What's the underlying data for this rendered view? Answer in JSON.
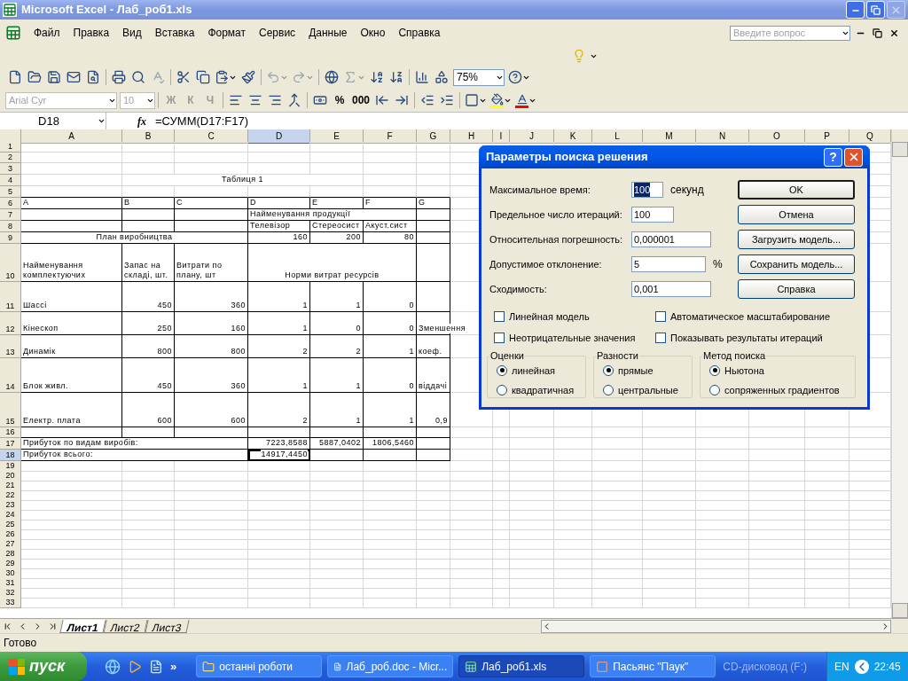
{
  "window": {
    "title": "Microsoft Excel - Лаб_роб1.xls"
  },
  "menu": [
    "Файл",
    "Правка",
    "Вид",
    "Вставка",
    "Формат",
    "Сервис",
    "Данные",
    "Окно",
    "Справка"
  ],
  "help_search": {
    "placeholder": "Введите вопрос"
  },
  "standard_toolbar": {
    "zoom": "75%",
    "buttons": [
      {
        "disabled": false
      },
      {
        "disabled": false
      },
      {
        "disabled": false
      },
      {
        "disabled": false
      },
      {
        "disabled": false
      },
      {
        "disabled": false
      },
      {
        "disabled": false
      },
      {
        "disabled": true
      },
      {
        "disabled": false
      },
      {
        "disabled": false
      },
      {
        "disabled": false
      },
      {
        "disabled": false
      },
      {
        "disabled": true
      },
      {
        "disabled": true
      },
      {
        "disabled": false
      },
      {
        "disabled": true
      },
      {
        "disabled": false
      },
      {
        "disabled": false
      },
      {
        "disabled": false
      },
      {
        "disabled": false
      },
      {
        "disabled": false
      }
    ]
  },
  "formatting_toolbar": {
    "font": {
      "value": "Arial Cyr",
      "disabled": true
    },
    "size": {
      "value": "10",
      "disabled": true
    },
    "buttons": [
      {
        "kind": "text",
        "label": "Ж",
        "disabled": true
      },
      {
        "kind": "text",
        "label": "К",
        "disabled": true
      },
      {
        "kind": "text",
        "label": "Ч",
        "disabled": true
      },
      {
        "kind": "icon",
        "disabled": false
      },
      {
        "kind": "icon",
        "disabled": false
      },
      {
        "kind": "icon",
        "disabled": false
      },
      {
        "kind": "icon",
        "disabled": false
      },
      {
        "kind": "icon",
        "disabled": false
      },
      {
        "kind": "text",
        "label": "%",
        "disabled": false
      },
      {
        "kind": "text",
        "label": "000",
        "disabled": false
      },
      {
        "kind": "icon",
        "disabled": false
      },
      {
        "kind": "icon",
        "disabled": false
      },
      {
        "kind": "icon",
        "disabled": false
      },
      {
        "kind": "icon",
        "disabled": false
      },
      {
        "kind": "icon",
        "disabled": false
      },
      {
        "kind": "icon",
        "disabled": false
      },
      {
        "kind": "icon",
        "disabled": false
      }
    ]
  },
  "formula_bar": {
    "name_box": "D18",
    "fx": "fx",
    "formula": "=СУММ(D17:F17)"
  },
  "sheet": {
    "columns": [
      {
        "label": "A",
        "selected": false
      },
      {
        "label": "B",
        "selected": false
      },
      {
        "label": "C",
        "selected": false
      },
      {
        "label": "D",
        "selected": true
      },
      {
        "label": "E",
        "selected": false
      },
      {
        "label": "F",
        "selected": false
      },
      {
        "label": "G",
        "selected": false
      },
      {
        "label": "H",
        "selected": false
      },
      {
        "label": "I",
        "selected": false
      },
      {
        "label": "J",
        "selected": false
      },
      {
        "label": "K",
        "selected": false
      },
      {
        "label": "L",
        "selected": false
      },
      {
        "label": "M",
        "selected": false
      },
      {
        "label": "N",
        "selected": false
      },
      {
        "label": "O",
        "selected": false
      },
      {
        "label": "P",
        "selected": false
      },
      {
        "label": "Q",
        "selected": false
      }
    ],
    "rows": [
      {
        "number": "1",
        "selected": false,
        "bordered": false
      },
      {
        "number": "2",
        "selected": false,
        "bordered": false
      },
      {
        "number": "3",
        "selected": false,
        "bordered": false
      },
      {
        "number": "4",
        "selected": false,
        "bordered": false,
        "cells": [
          {
            "kind": "empty"
          },
          {
            "kind": "heading",
            "text": "Таблиця 1"
          },
          {
            "kind": "merged"
          },
          {
            "kind": "merged"
          },
          {
            "kind": "merged"
          }
        ]
      },
      {
        "number": "5",
        "selected": false,
        "bordered": false
      },
      {
        "number": "6",
        "selected": false,
        "bordered": true,
        "cells": [
          {
            "kind": "label",
            "text": "A"
          },
          {
            "kind": "label",
            "text": "B"
          },
          {
            "kind": "label",
            "text": "C"
          },
          {
            "kind": "label",
            "text": "D"
          },
          {
            "kind": "label",
            "text": "E"
          },
          {
            "kind": "label",
            "text": "F"
          },
          {
            "kind": "label",
            "text": "G"
          }
        ]
      },
      {
        "number": "7",
        "selected": false,
        "bordered": true,
        "cells": [
          {
            "kind": "empty"
          },
          {
            "kind": "empty"
          },
          {
            "kind": "empty"
          },
          {
            "kind": "label",
            "text": "Найменування продукції"
          },
          {
            "kind": "merged"
          },
          {
            "kind": "merged"
          },
          {
            "kind": "empty"
          }
        ]
      },
      {
        "number": "8",
        "selected": false,
        "bordered": true,
        "cells": [
          {
            "kind": "empty"
          },
          {
            "kind": "empty"
          },
          {
            "kind": "empty"
          },
          {
            "kind": "label",
            "text": "Телевізор"
          },
          {
            "kind": "label",
            "text": "Стереосист"
          },
          {
            "kind": "label",
            "text": "Акуст.сист"
          },
          {
            "kind": "empty"
          }
        ]
      },
      {
        "number": "9",
        "selected": false,
        "bordered": true,
        "cells": [
          {
            "kind": "heading",
            "text": "План виробництва"
          },
          {
            "kind": "merged"
          },
          {
            "kind": "merged"
          },
          {
            "kind": "number",
            "text": "160"
          },
          {
            "kind": "number",
            "text": "200"
          },
          {
            "kind": "number",
            "text": "80"
          },
          {
            "kind": "empty"
          }
        ]
      },
      {
        "number": "10",
        "selected": false,
        "bordered": true,
        "cells": [
          {
            "kind": "wrapped",
            "text": "Найменування комплектуючих"
          },
          {
            "kind": "wrapped",
            "text": "Запас на складі, шт."
          },
          {
            "kind": "wrapped",
            "text": "Витрати по плану, шт"
          },
          {
            "kind": "heading",
            "text": "Норми витрат ресурсів"
          },
          {
            "kind": "merged"
          },
          {
            "kind": "merged"
          },
          {
            "kind": "empty"
          }
        ]
      },
      {
        "number": "11",
        "selected": false,
        "bordered": true,
        "cells": [
          {
            "kind": "label",
            "text": "Шассі"
          },
          {
            "kind": "number",
            "text": "450"
          },
          {
            "kind": "number",
            "text": "360"
          },
          {
            "kind": "number",
            "text": "1"
          },
          {
            "kind": "number",
            "text": "1"
          },
          {
            "kind": "number",
            "text": "0"
          },
          {
            "kind": "empty"
          }
        ]
      },
      {
        "number": "12",
        "selected": false,
        "bordered": true,
        "cells": [
          {
            "kind": "label",
            "text": "Кінескоп"
          },
          {
            "kind": "number",
            "text": "250"
          },
          {
            "kind": "number",
            "text": "160"
          },
          {
            "kind": "number",
            "text": "1"
          },
          {
            "kind": "number",
            "text": "0"
          },
          {
            "kind": "number",
            "text": "0"
          },
          {
            "kind": "label",
            "text": "Зменшення"
          }
        ]
      },
      {
        "number": "13",
        "selected": false,
        "bordered": true,
        "cells": [
          {
            "kind": "label",
            "text": "Динамік"
          },
          {
            "kind": "number",
            "text": "800"
          },
          {
            "kind": "number",
            "text": "800"
          },
          {
            "kind": "number",
            "text": "2"
          },
          {
            "kind": "number",
            "text": "2"
          },
          {
            "kind": "number",
            "text": "1"
          },
          {
            "kind": "label",
            "text": "коеф."
          }
        ]
      },
      {
        "number": "14",
        "selected": false,
        "bordered": true,
        "cells": [
          {
            "kind": "label",
            "text": "Блок живл."
          },
          {
            "kind": "number",
            "text": "450"
          },
          {
            "kind": "number",
            "text": "360"
          },
          {
            "kind": "number",
            "text": "1"
          },
          {
            "kind": "number",
            "text": "1"
          },
          {
            "kind": "number",
            "text": "0"
          },
          {
            "kind": "label",
            "text": "віддачі"
          }
        ]
      },
      {
        "number": "15",
        "selected": false,
        "bordered": true,
        "cells": [
          {
            "kind": "label",
            "text": "Електр. плата"
          },
          {
            "kind": "number",
            "text": "600"
          },
          {
            "kind": "number",
            "text": "600"
          },
          {
            "kind": "number",
            "text": "2"
          },
          {
            "kind": "number",
            "text": "1"
          },
          {
            "kind": "number",
            "text": "1"
          },
          {
            "kind": "number",
            "text": "0,9"
          }
        ]
      },
      {
        "number": "16",
        "selected": false,
        "bordered": true
      },
      {
        "number": "17",
        "selected": false,
        "bordered": true,
        "cells": [
          {
            "kind": "label",
            "text": "Прибуток по видам виробів:"
          },
          {
            "kind": "merged"
          },
          {
            "kind": "merged"
          },
          {
            "kind": "number",
            "text": "7223,8588"
          },
          {
            "kind": "number",
            "text": "5887,0402"
          },
          {
            "kind": "number",
            "text": "1806,5460"
          },
          {
            "kind": "empty"
          }
        ]
      },
      {
        "number": "18",
        "selected": true,
        "bordered": true,
        "cells": [
          {
            "kind": "label",
            "text": "Прибуток всього:"
          },
          {
            "kind": "merged"
          },
          {
            "kind": "merged"
          },
          {
            "kind": "number",
            "text": "14917,4450"
          },
          {
            "kind": "empty"
          },
          {
            "kind": "empty"
          },
          {
            "kind": "empty"
          }
        ]
      },
      {
        "number": "19",
        "selected": false,
        "bordered": false
      },
      {
        "number": "20",
        "selected": false,
        "bordered": false
      },
      {
        "number": "21",
        "selected": false,
        "bordered": false
      },
      {
        "number": "22",
        "selected": false,
        "bordered": false
      },
      {
        "number": "23",
        "selected": false,
        "bordered": false
      },
      {
        "number": "24",
        "selected": false,
        "bordered": false
      },
      {
        "number": "25",
        "selected": false,
        "bordered": false
      },
      {
        "number": "26",
        "selected": false,
        "bordered": false
      },
      {
        "number": "27",
        "selected": false,
        "bordered": false
      },
      {
        "number": "28",
        "selected": false,
        "bordered": false
      },
      {
        "number": "29",
        "selected": false,
        "bordered": false
      },
      {
        "number": "30",
        "selected": false,
        "bordered": false
      },
      {
        "number": "31",
        "selected": false,
        "bordered": false
      },
      {
        "number": "32",
        "selected": false,
        "bordered": false
      },
      {
        "number": "33",
        "selected": false,
        "bordered": false
      }
    ]
  },
  "sheet_tabs": [
    {
      "label": "Лист1",
      "selected": true
    },
    {
      "label": "Лист2",
      "selected": false
    },
    {
      "label": "Лист3",
      "selected": false
    }
  ],
  "status_bar": "Готово",
  "dialog": {
    "title": "Параметры поиска решения",
    "help": "?",
    "fields": [
      {
        "label": "Максимальное время:",
        "value": "100",
        "unit": "секунд",
        "focused": true
      },
      {
        "label": "Предельное число итераций:",
        "value": "100",
        "focused": false
      },
      {
        "label": "Относительная погрешность:",
        "value": "0,000001",
        "focused": false
      },
      {
        "label": "Допустимое отклонение:",
        "value": "5",
        "unit": "%",
        "focused": false
      },
      {
        "label": "Сходимость:",
        "value": "0,001",
        "focused": false
      }
    ],
    "buttons": [
      {
        "label": "OK",
        "default": true
      },
      {
        "label": "Отмена",
        "default": false
      },
      {
        "label": "Загрузить модель...",
        "default": false
      },
      {
        "label": "Сохранить модель...",
        "default": false
      },
      {
        "label": "Справка",
        "default": false
      }
    ],
    "checkboxes": [
      {
        "label": "Линейная модель",
        "checked": false
      },
      {
        "label": "Автоматическое масштабирование",
        "checked": false
      },
      {
        "label": "Неотрицательные значения",
        "checked": false
      },
      {
        "label": "Показывать результаты итераций",
        "checked": false
      }
    ],
    "groups": [
      {
        "title": "Оценки",
        "options": [
          {
            "label": "линейная",
            "selected": true
          },
          {
            "label": "квадратичная",
            "selected": false
          }
        ]
      },
      {
        "title": "Разности",
        "options": [
          {
            "label": "прямые",
            "selected": true
          },
          {
            "label": "центральные",
            "selected": false
          }
        ]
      },
      {
        "title": "Метод поиска",
        "options": [
          {
            "label": "Ньютона",
            "selected": true
          },
          {
            "label": "сопряженных градиентов",
            "selected": false
          }
        ]
      }
    ]
  },
  "taskbar": {
    "start": "пуск",
    "chevron": "»",
    "tasks": [
      {
        "label": "останні роботи",
        "selected": false
      },
      {
        "label": "Лаб_роб.doc - Micr...",
        "selected": false
      },
      {
        "label": "Лаб_роб1.xls",
        "selected": true
      },
      {
        "label": "Пасьянс \"Паук\"",
        "selected": false
      }
    ],
    "toolbar_label": "CD-дисковод (F:)",
    "language": "EN",
    "clock": "22:45"
  }
}
